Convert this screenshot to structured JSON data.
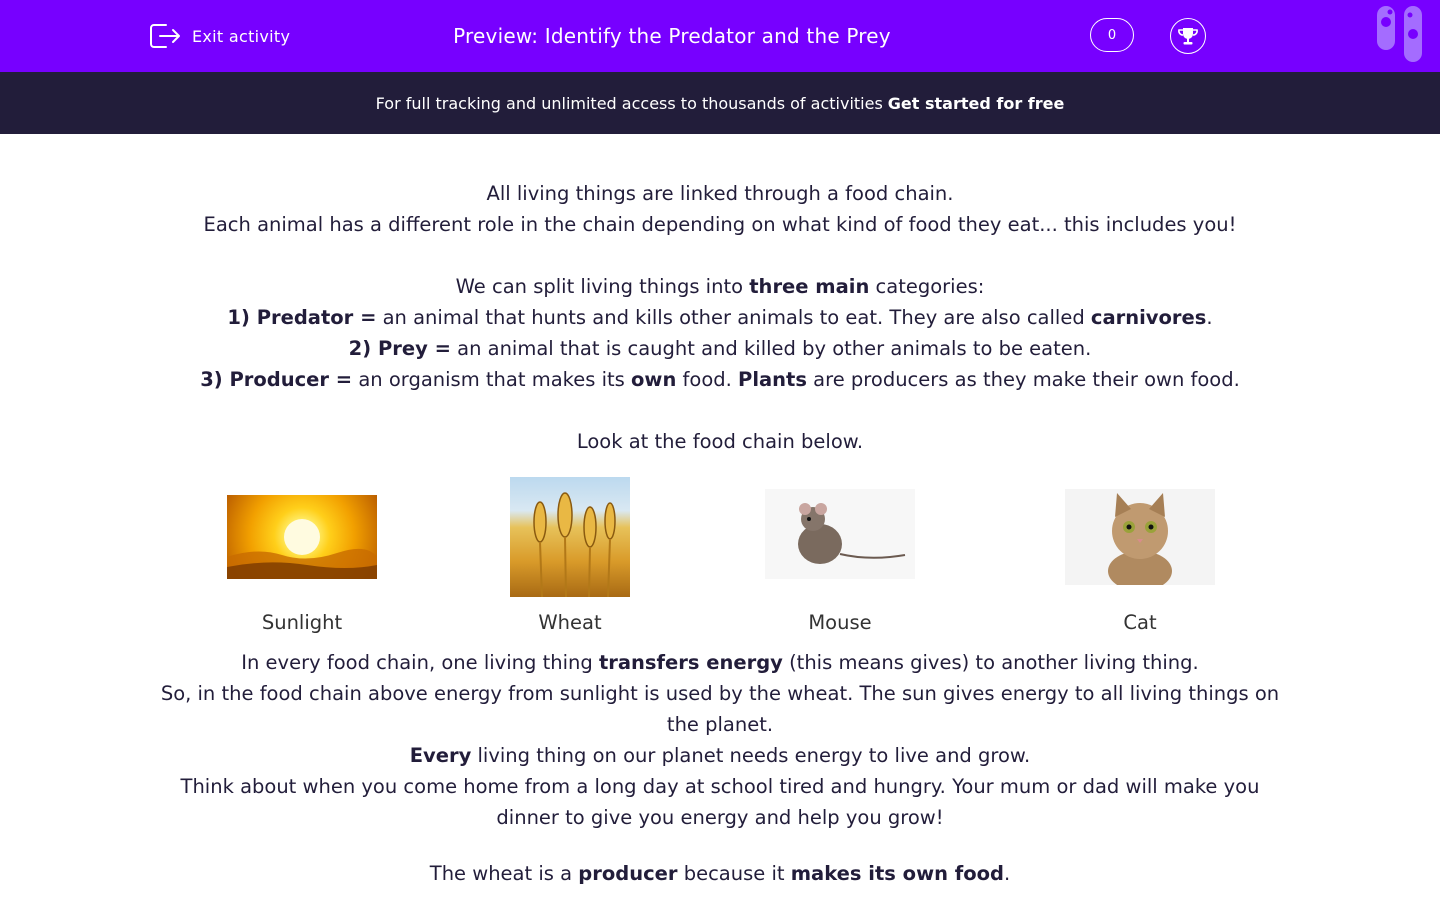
{
  "header": {
    "exit_label": "Exit activity",
    "title": "Preview: Identify the Predator and the Prey",
    "score": "0",
    "accent_color": "#7700ff"
  },
  "banner": {
    "text": "For full tracking and unlimited access to thousands of activities",
    "cta": "Get started for free"
  },
  "content": {
    "intro1": "All living things are linked through a food chain.",
    "intro2": "Each animal has a different role in the chain depending on what kind of food they eat... this includes you!",
    "cat_a": "We can split living things into ",
    "cat_b": "three main",
    "cat_c": " categories:",
    "pred_a": "1) Predator =",
    "pred_b": " an animal that hunts and kills other animals to eat. They are also called ",
    "pred_c": "carnivores",
    "pred_d": ".",
    "prey_a": "2) Prey =",
    "prey_b": " an animal that is caught and killed by other animals to be eaten.",
    "prod_a": "3) Producer =",
    "prod_b": " an organism that makes its ",
    "prod_c": "own",
    "prod_d": " food. ",
    "prod_e": "Plants",
    "prod_f": " are producers as they make their own food.",
    "look": "Look at the food chain below.",
    "chain": [
      {
        "label": "Sunlight",
        "icon": "sun-image"
      },
      {
        "label": "Wheat",
        "icon": "wheat-image"
      },
      {
        "label": "Mouse",
        "icon": "mouse-image"
      },
      {
        "label": "Cat",
        "icon": "cat-image"
      }
    ],
    "energy_a": "In every food chain, one living thing ",
    "energy_b": "transfers energy",
    "energy_c": " (this means gives) to another living thing.",
    "so_line": "So, in the food chain above energy from sunlight is used by the wheat. The sun gives energy to all living things on the planet.",
    "every_a": "Every",
    "every_b": " living thing on our planet needs energy to live and grow.",
    "think": "Think about when you come home from a long day at school tired and hungry. Your mum or dad will make you dinner to give you energy and help you grow!",
    "wheat_a": "The wheat is a ",
    "wheat_b": "producer",
    "wheat_c": " because it ",
    "wheat_d": "makes its own food",
    "wheat_e": "."
  }
}
